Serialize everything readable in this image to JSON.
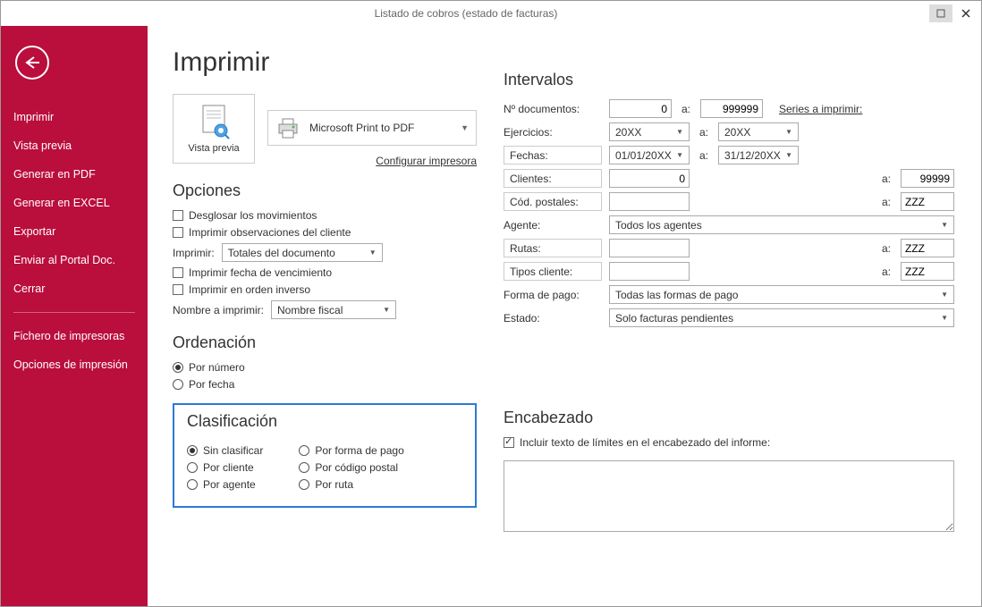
{
  "window": {
    "title": "Listado de cobros (estado de facturas)"
  },
  "sidebar": {
    "items": [
      "Imprimir",
      "Vista previa",
      "Generar en PDF",
      "Generar en EXCEL",
      "Exportar",
      "Enviar al Portal Doc.",
      "Cerrar"
    ],
    "footer": [
      "Fichero de impresoras",
      "Opciones de impresión"
    ]
  },
  "main": {
    "heading": "Imprimir",
    "vista_previa": "Vista previa",
    "printer": "Microsoft Print to PDF",
    "config_link": "Configurar impresora"
  },
  "opciones": {
    "title": "Opciones",
    "chk1": "Desglosar los movimientos",
    "chk2": "Imprimir observaciones del cliente",
    "imprimir_lbl": "Imprimir:",
    "imprimir_val": "Totales del documento",
    "chk3": "Imprimir fecha de vencimiento",
    "chk4": "Imprimir en orden inverso",
    "nombre_lbl": "Nombre a imprimir:",
    "nombre_val": "Nombre fiscal"
  },
  "orden": {
    "title": "Ordenación",
    "r1": "Por número",
    "r2": "Por fecha"
  },
  "clasif": {
    "title": "Clasificación",
    "c1": "Sin clasificar",
    "c2": "Por cliente",
    "c3": "Por agente",
    "c4": "Por forma de pago",
    "c5": "Por código postal",
    "c6": "Por ruta"
  },
  "intervalos": {
    "title": "Intervalos",
    "ndoc_lbl": "Nº documentos:",
    "ndoc_from": "0",
    "a": "a:",
    "ndoc_to": "999999",
    "series_link": "Series a imprimir:",
    "ejerc_lbl": "Ejercicios:",
    "ejerc_from": "20XX",
    "ejerc_to": "20XX",
    "fechas_lbl": "Fechas:",
    "fechas_from": "01/01/20XX",
    "fechas_to": "31/12/20XX",
    "clientes_lbl": "Clientes:",
    "clientes_from": "0",
    "clientes_to": "99999",
    "cp_lbl": "Cód. postales:",
    "cp_from": "",
    "cp_to": "ZZZ",
    "agente_lbl": "Agente:",
    "agente_val": "Todos los agentes",
    "rutas_lbl": "Rutas:",
    "rutas_from": "",
    "rutas_to": "ZZZ",
    "tipos_lbl": "Tipos cliente:",
    "tipos_from": "",
    "tipos_to": "ZZZ",
    "forma_lbl": "Forma de pago:",
    "forma_val": "Todas las formas de pago",
    "estado_lbl": "Estado:",
    "estado_val": "Solo facturas pendientes"
  },
  "encabezado": {
    "title": "Encabezado",
    "chk": "Incluir texto de límites en el encabezado del informe:"
  }
}
